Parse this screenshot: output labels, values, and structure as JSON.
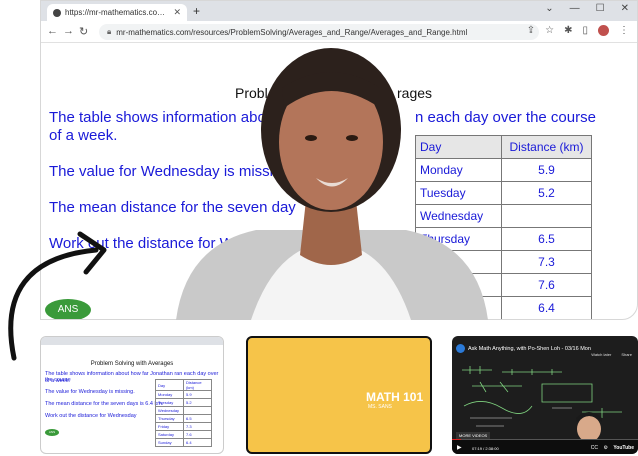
{
  "browser": {
    "tab_title": "https://mr-mathematics.com/re...",
    "url": "mr-mathematics.com/resources/ProblemSolving/Averages_and_Range/Averages_and_Range.html"
  },
  "slide": {
    "title_left": "Probl",
    "title_right": "rages",
    "line1a": "The table shows information abo",
    "line1b": "n each day over the course",
    "line1c": "of a week.",
    "line2": "The value for Wednesday is missi",
    "line3": "The mean distance for the seven day",
    "line4": "Work out the distance for W",
    "ans_label": "ANS",
    "table_headers": [
      "Day",
      "Distance (km)"
    ],
    "table_rows": [
      {
        "day": "Monday",
        "value": "5.9"
      },
      {
        "day": "Tuesday",
        "value": "5.2"
      },
      {
        "day": "Wednesday",
        "value": ""
      },
      {
        "day": "Thursday",
        "value": "6.5"
      },
      {
        "day": "",
        "value": "7.3"
      },
      {
        "day": "",
        "value": "7.6"
      },
      {
        "day": "",
        "value": "6.4"
      }
    ]
  },
  "thumb_slide": {
    "title": "Problem Solving with Averages",
    "line1": "The table shows information about how far Jonathan ran each day over the course",
    "line1b": "of a week.",
    "line2": "The value for Wednesday is missing.",
    "line3": "The mean distance for the seven days is 6.4 km.",
    "line4": "Work out the distance for Wednesday",
    "ans": "ANS",
    "headers": [
      "Day",
      "Distance (km)"
    ],
    "rows": [
      {
        "day": "Monday",
        "value": "5.9"
      },
      {
        "day": "Tuesday",
        "value": "5.2"
      },
      {
        "day": "Wednesday",
        "value": ""
      },
      {
        "day": "Thursday",
        "value": "6.5"
      },
      {
        "day": "Friday",
        "value": "7.3"
      },
      {
        "day": "Saturday",
        "value": "7.6"
      },
      {
        "day": "Sunday",
        "value": "6.4"
      }
    ]
  },
  "thumb_math": {
    "title": "MATH 101",
    "subtitle": "MS. SANS"
  },
  "thumb_video": {
    "title": "Ask Math Anything, with Po-Shen Loh - 03/16 Mon",
    "watch_later": "Watch later",
    "share": "Share",
    "more_videos": "MORE VIDEOS",
    "time": "07:19 / 2:38:00",
    "progress": 0.05,
    "brand": "YouTube"
  }
}
